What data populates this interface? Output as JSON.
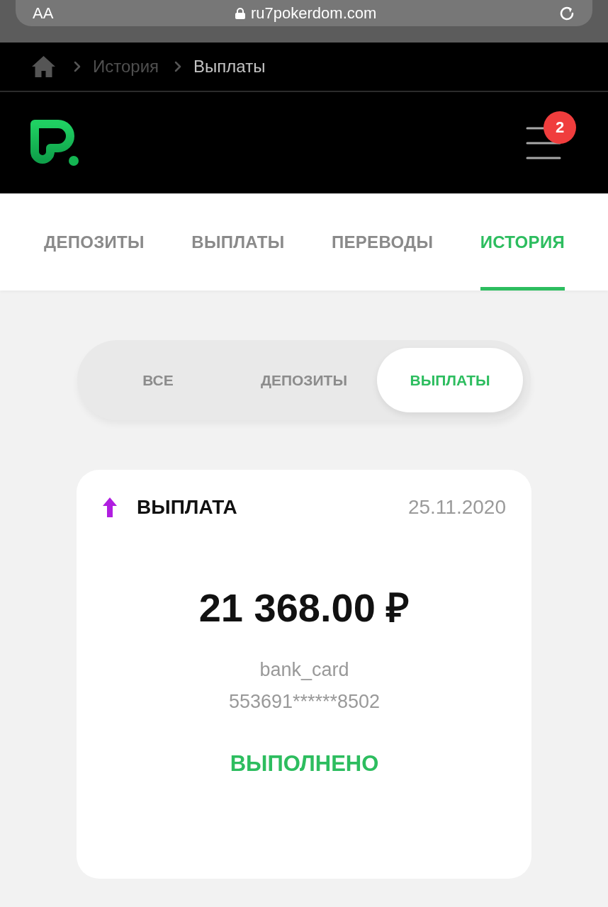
{
  "browser": {
    "reader_button": "AA",
    "url": "ru7pokerdom.com"
  },
  "breadcrumbs": [
    {
      "label": "История",
      "current": false
    },
    {
      "label": "Выплаты",
      "current": true
    }
  ],
  "header": {
    "notifications": "2"
  },
  "tabs": [
    {
      "label": "ДЕПОЗИТЫ",
      "selected": false
    },
    {
      "label": "ВЫПЛАТЫ",
      "selected": false
    },
    {
      "label": "ПЕРЕВОДЫ",
      "selected": false
    },
    {
      "label": "ИСТОРИЯ",
      "selected": true
    }
  ],
  "filter": [
    {
      "label": "ВСЕ",
      "selected": false
    },
    {
      "label": "ДЕПОЗИТЫ",
      "selected": false
    },
    {
      "label": "ВЫПЛАТЫ",
      "selected": true
    }
  ],
  "transactions": [
    {
      "kind": "withdrawal",
      "title": "ВЫПЛАТА",
      "date": "25.11.2020",
      "amount": "21 368.00 ₽",
      "method": "bank_card",
      "account": "553691******8502",
      "status": "ВЫПОЛНЕНО",
      "completed": true
    }
  ]
}
